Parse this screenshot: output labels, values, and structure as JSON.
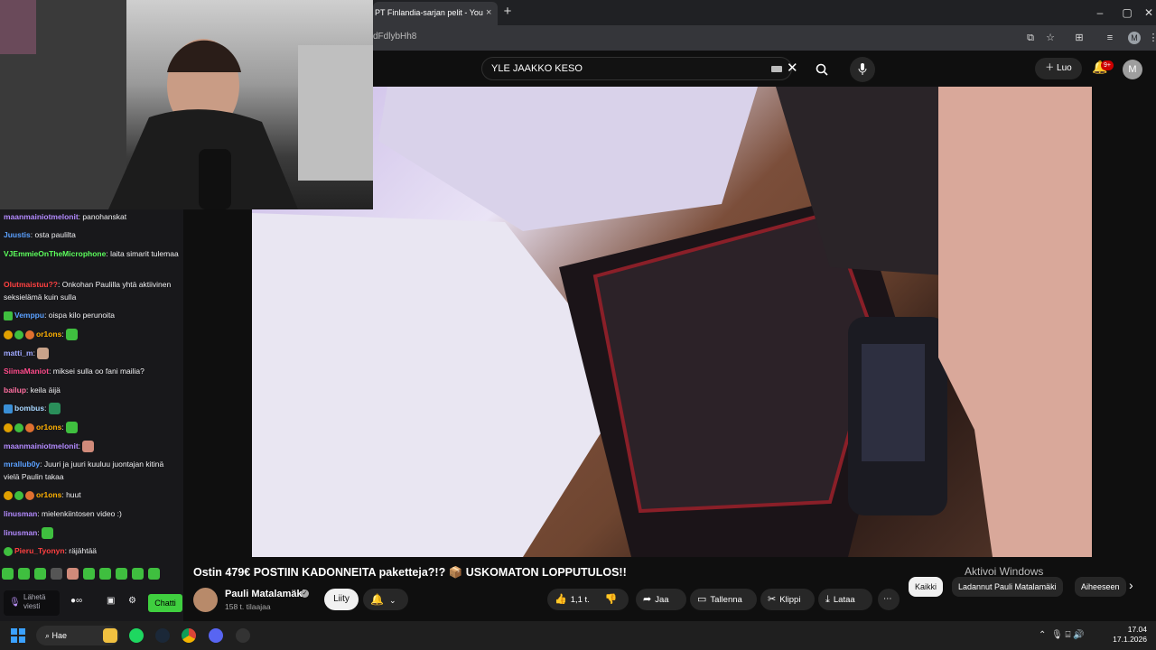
{
  "browser": {
    "tab_title": "PT Finlandia-sarjan pelit - You",
    "tab_close": "×",
    "new_tab": "+",
    "url": "dFdlybHh8",
    "profile_initial": "M"
  },
  "youtube": {
    "search_value": "YLE JAAKKO KESO",
    "create_label": "Luo",
    "notifications_badge": "9+",
    "avatar_initial": "M",
    "video_title": "Ostin 479€ POSTIIN KADONNEITA paketteja?!? 📦 USKOMATON LOPPUTULOS!!",
    "channel_name": "Pauli Matalamäki",
    "subscribers": "158 t. tilaajaa",
    "join_label": "Liity",
    "likes": "1,1 t.",
    "share_label": "Jaa",
    "save_label": "Tallenna",
    "clip_label": "Klippi",
    "download_label": "Lataa",
    "chips": [
      "Kaikki",
      "Ladannut Pauli Matalamäki",
      "Aiheeseen"
    ],
    "activate_windows": "Aktivoi Windows"
  },
  "chat": {
    "messages": [
      {
        "user": "maanmainiotmelonit",
        "color": "#b38aff",
        "text": ": panohanskat"
      },
      {
        "user": "Juustis",
        "color": "#5aa0ff",
        "text": ": osta paulilta"
      },
      {
        "user": "VJEmmieOnTheMicrophone",
        "color": "#5cff5c",
        "text": ": laita simarit tulemaa"
      },
      {
        "user": "Olutmaistuu??",
        "color": "#ff4040",
        "text": ": Onkohan Paulilla yhtä aktiivinen seksielämä kuin sulla"
      },
      {
        "user": "Vemppu",
        "color": "#5aa0ff",
        "text": ": oispa kilo perunoita"
      },
      {
        "user": "or1ons",
        "color": "#ffb000",
        "text": ":"
      },
      {
        "user": "matti_m",
        "color": "#9fa8ff",
        "text": ":"
      },
      {
        "user": "SiimaManiot",
        "color": "#ff4a8a",
        "text": ": miksei sulla oo fani mailia?"
      },
      {
        "user": "bailup",
        "color": "#ff6fa0",
        "text": ": keila äijä"
      },
      {
        "user": "bombus",
        "color": "#a6d6ff",
        "text": ":"
      },
      {
        "user": "or1ons",
        "color": "#ffb000",
        "text": ":"
      },
      {
        "user": "maanmainiotmelonit",
        "color": "#b38aff",
        "text": ":"
      },
      {
        "user": "mrallub0y",
        "color": "#5aa0ff",
        "text": ": Juuri ja juuri kuuluu juontajan kitinä vielä Paulin takaa"
      },
      {
        "user": "or1ons",
        "color": "#ffb000",
        "text": ": huut"
      },
      {
        "user": "linusman",
        "color": "#b38aff",
        "text": ": mielenkiintosen video :)"
      },
      {
        "user": "linusman",
        "color": "#b38aff",
        "text": ":"
      },
      {
        "user": "Pieru_Tyonyn",
        "color": "#ff4040",
        "text": ": räjähtää"
      }
    ],
    "input_placeholder": "Lähetä viesti",
    "send_label": "Chatti"
  },
  "taskbar": {
    "search_label": "Hae",
    "time": "17.04",
    "date": "17.1.2026"
  },
  "colors": {
    "accent_twitch": "#3fcf3f",
    "yt_red": "#cc0000"
  }
}
